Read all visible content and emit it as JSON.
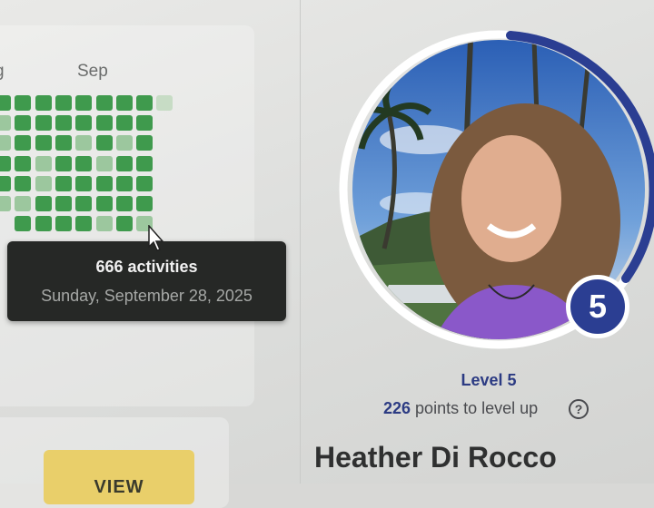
{
  "heatmap": {
    "months": [
      "g",
      "Sep"
    ],
    "tooltip": {
      "count_text": "666 activities",
      "date_text": "Sunday, September 28, 2025"
    },
    "colors": {
      "dark": "#3f9a4d",
      "light": "#9cc79e",
      "pale": "#c7dcc5"
    }
  },
  "view_button": {
    "label": "VIEW"
  },
  "profile": {
    "level_number": "5",
    "level_label": "Level 5",
    "points_value": "226",
    "points_suffix": " points to level up",
    "name": "Heather Di Rocco",
    "accent_color": "#2b3e92"
  }
}
